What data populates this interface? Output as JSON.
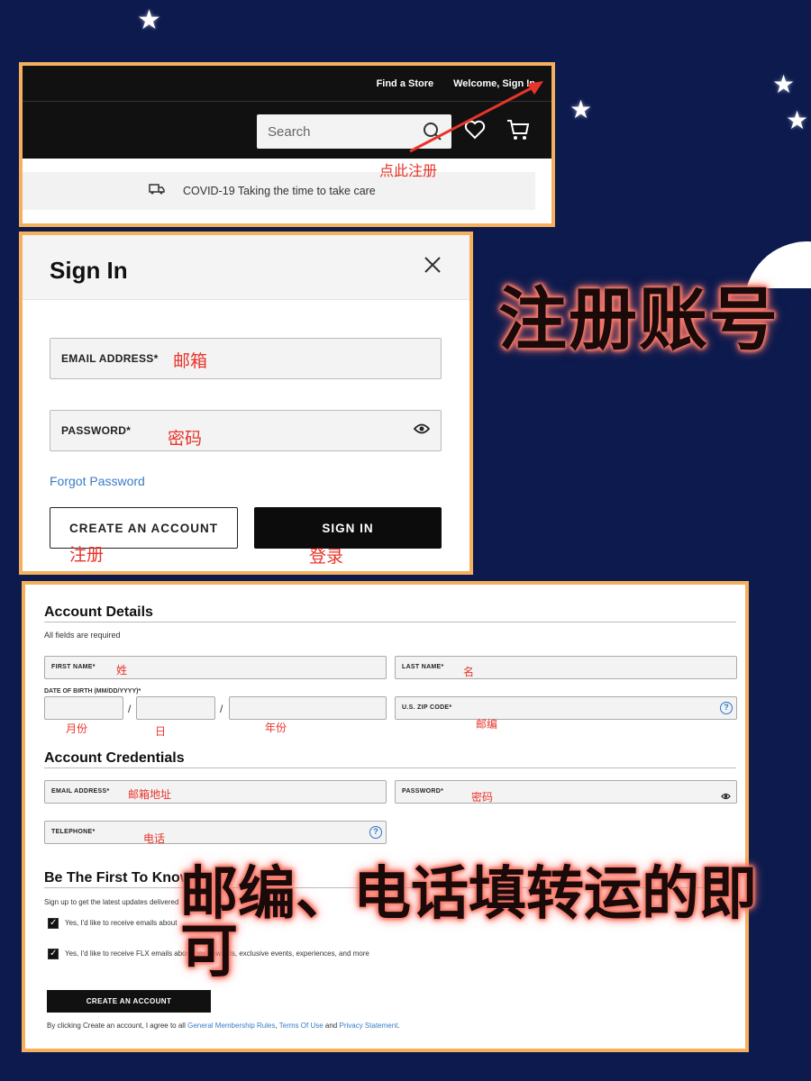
{
  "decor": {
    "star_glyph": "★",
    "headline": "注册账号",
    "note": "邮编、电话填转运的即可"
  },
  "header": {
    "top_links": [
      "Find a Store",
      "Welcome, Sign In"
    ],
    "search_placeholder": "Search",
    "banner_text": "COVID-19 Taking the time to take care",
    "annotation": "点此注册"
  },
  "signin": {
    "title": "Sign In",
    "email_label": "EMAIL ADDRESS*",
    "email_annotation": "邮箱",
    "password_label": "PASSWORD*",
    "password_annotation": "密码",
    "forgot_link": "Forgot Password",
    "create_button": "CREATE AN ACCOUNT",
    "create_annotation": "注册",
    "signin_button": "SIGN IN",
    "signin_annotation": "登录"
  },
  "account_form": {
    "details_heading": "Account Details",
    "required_note": "All fields are required",
    "first_name_label": "FIRST NAME*",
    "first_name_annotation": "姓",
    "last_name_label": "LAST NAME*",
    "last_name_annotation": "名",
    "dob_label": "DATE OF BIRTH (MM/DD/YYYY)*",
    "dob_separator": "/",
    "dob_annotations": [
      "月份",
      "日",
      "年份"
    ],
    "zip_label": "U.S. ZIP CODE*",
    "zip_annotation": "邮编",
    "credentials_heading": "Account Credentials",
    "email_label": "EMAIL ADDRESS*",
    "email_annotation": "邮箱地址",
    "password_label": "PASSWORD*",
    "password_annotation": "密码",
    "telephone_label": "TELEPHONE*",
    "telephone_annotation": "电话",
    "help_glyph": "?",
    "know_heading": "Be The First To Know",
    "signup_text": "Sign up to get the latest updates delivered",
    "checkbox_1": "Yes, I'd like to receive emails about",
    "checkbox_1_checked": true,
    "checkbox_2": "Yes, I'd like to receive FLX emails about new rewards, exclusive events, experiences, and more",
    "checkbox_2_checked": true,
    "create_button": "CREATE AN ACCOUNT",
    "terms_prefix": "By clicking Create an account, I agree to all ",
    "terms_link_1": "General Membership Rules",
    "terms_sep": ", ",
    "terms_link_2": "Terms Of Use",
    "terms_and": " and ",
    "terms_link_3": "Privacy Statement",
    "terms_end": "."
  }
}
